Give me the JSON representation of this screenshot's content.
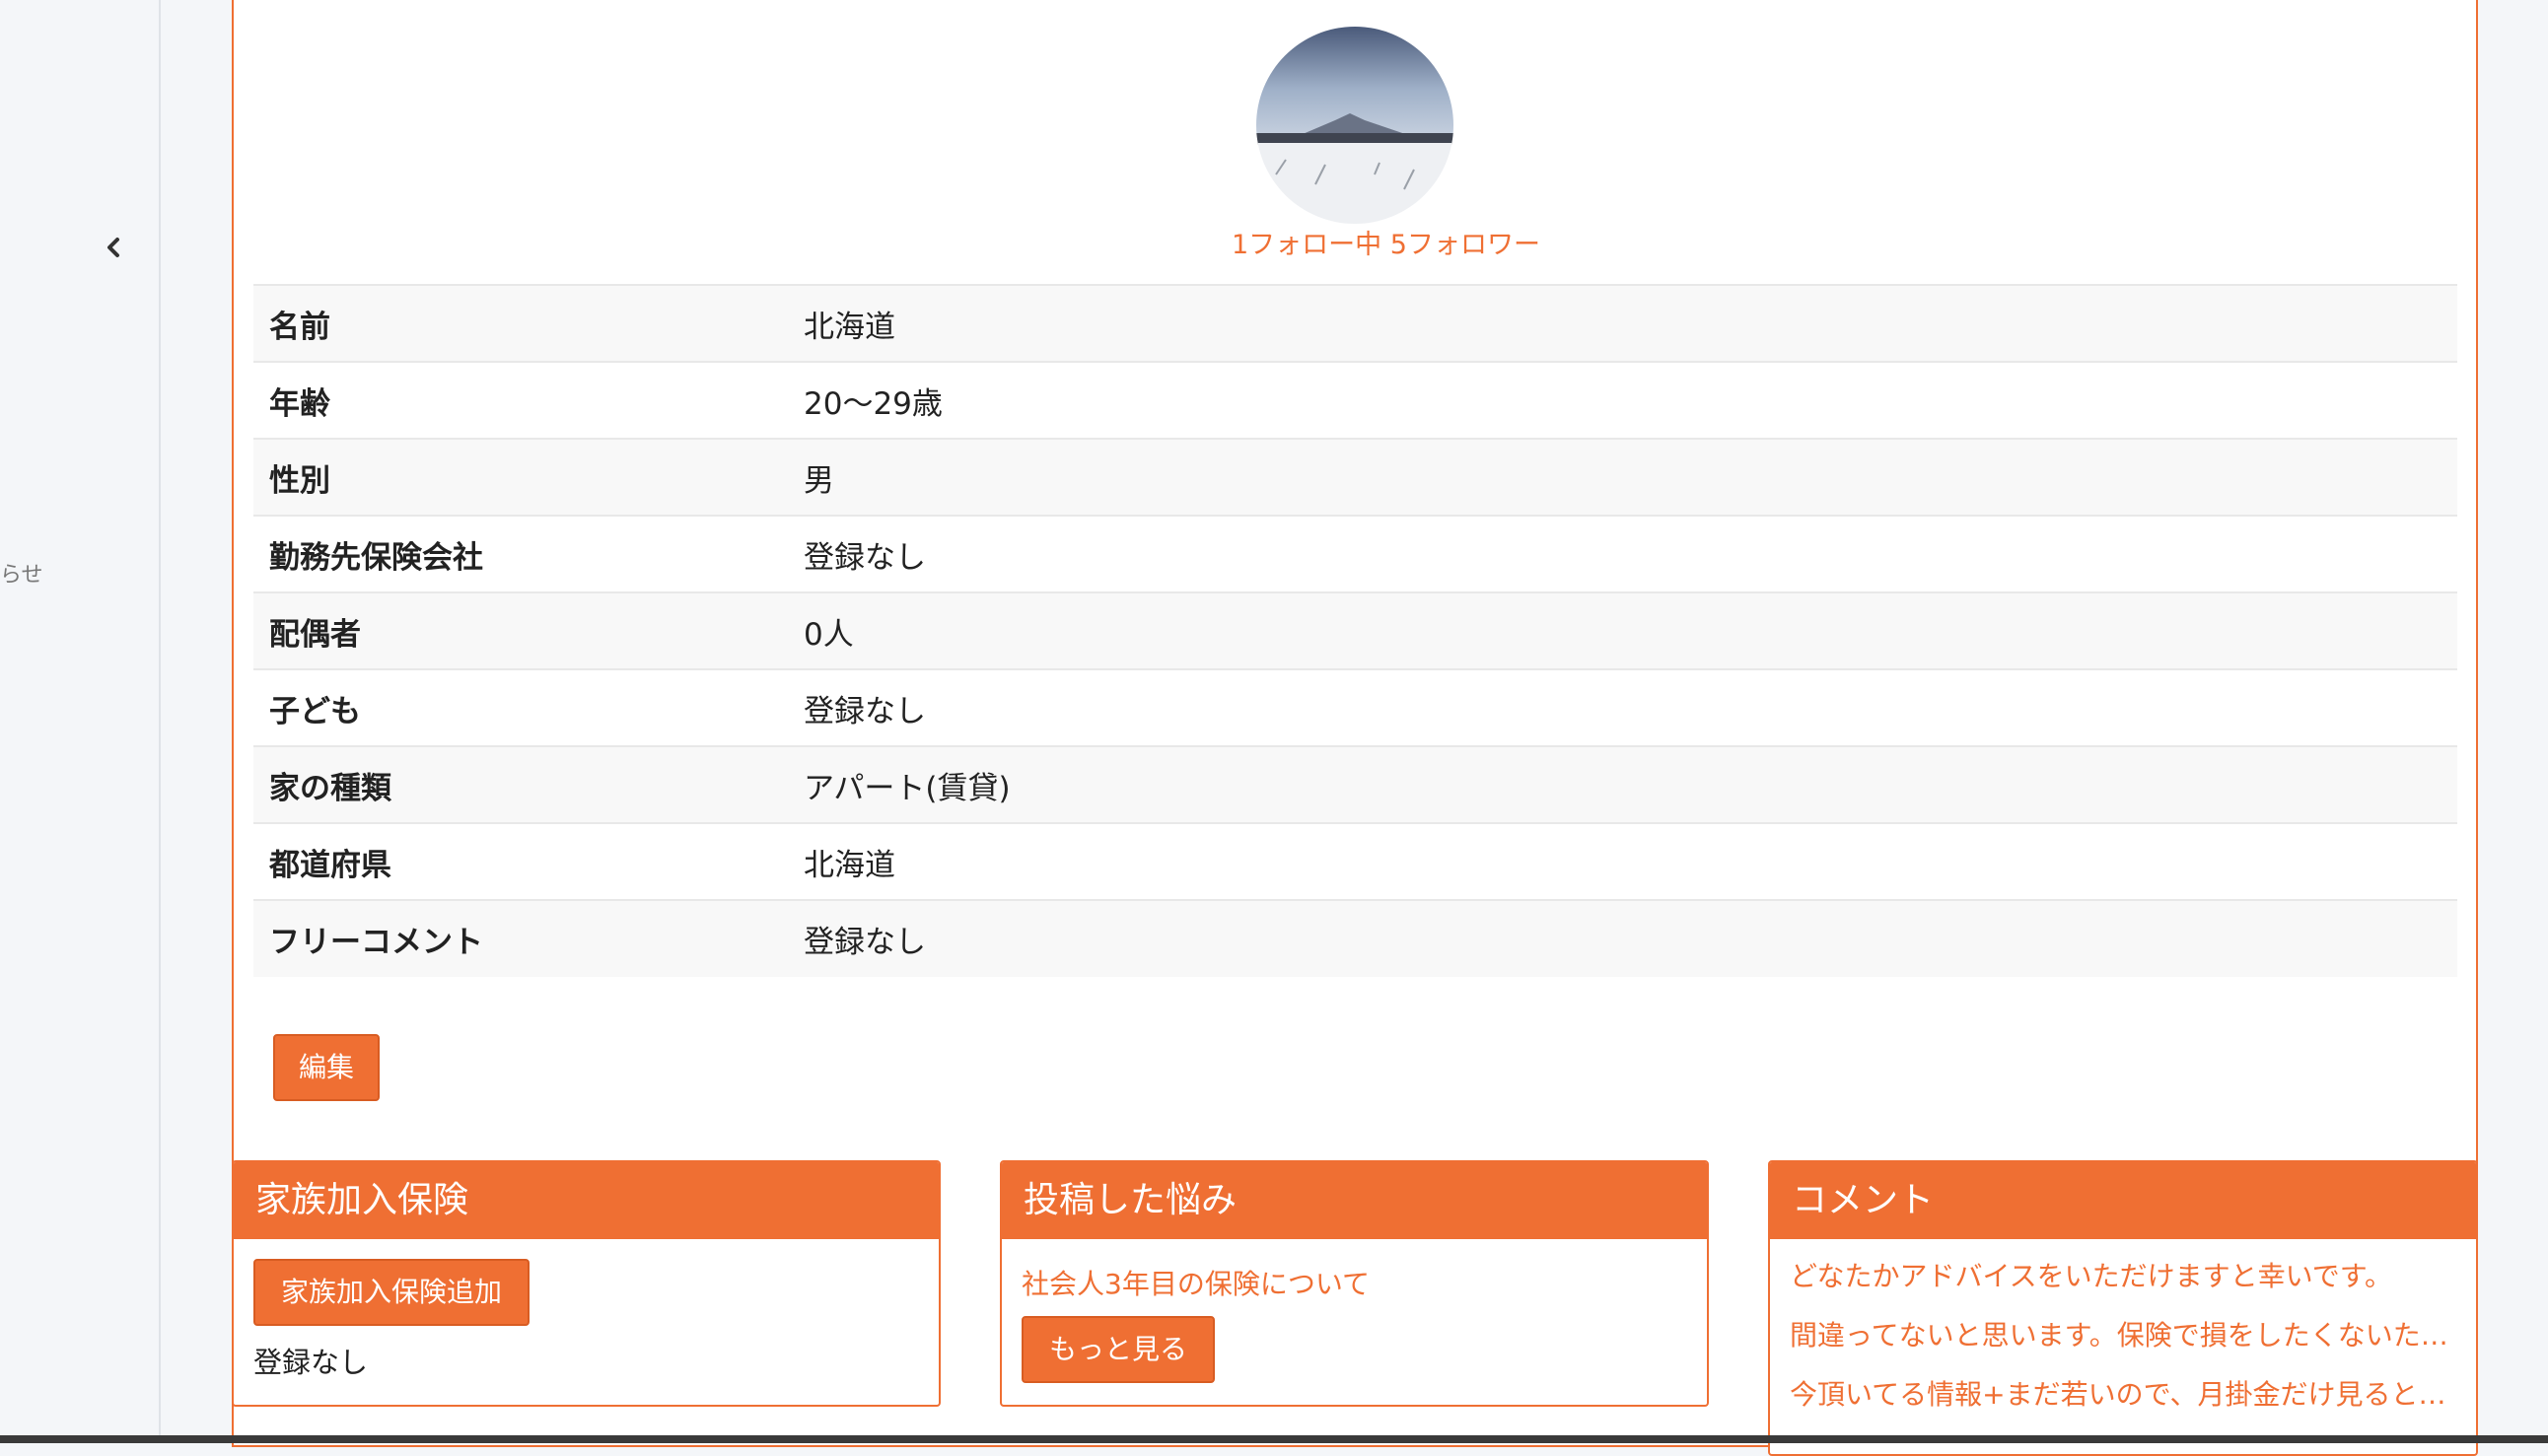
{
  "sidebar": {
    "collapse_icon": "chevron-left-icon",
    "notice_fragment": "らせ"
  },
  "profile": {
    "avatar_icon": "mountain-snow-photo",
    "follow_text": "1フォロー中 5フォロワー",
    "rows": [
      {
        "label": "名前",
        "value": "北海道"
      },
      {
        "label": "年齢",
        "value": "20〜29歳"
      },
      {
        "label": "性別",
        "value": "男"
      },
      {
        "label": "勤務先保険会社",
        "value": "登録なし"
      },
      {
        "label": "配偶者",
        "value": "0人"
      },
      {
        "label": "子ども",
        "value": "登録なし"
      },
      {
        "label": "家の種類",
        "value": "アパート(賃貸)"
      },
      {
        "label": "都道府県",
        "value": "北海道"
      },
      {
        "label": "フリーコメント",
        "value": "登録なし"
      }
    ],
    "edit_label": "編集"
  },
  "family_panel": {
    "title": "家族加入保険",
    "add_label": "家族加入保険追加",
    "empty_text": "登録なし"
  },
  "posts_panel": {
    "title": "投稿した悩み",
    "post_link": "社会人3年目の保険について",
    "more_label": "もっと見る"
  },
  "comments_panel": {
    "title": "コメント",
    "items": [
      "どなたかアドバイスをいただけますと幸いです。",
      "間違ってないと思います。保険で損をしたくないた…",
      "今頂いてる情報+まだ若いので、月掛金だけ見ると…"
    ]
  },
  "colors": {
    "accent": "#ef6f33",
    "sidebar_bg": "#f4f6f9"
  }
}
